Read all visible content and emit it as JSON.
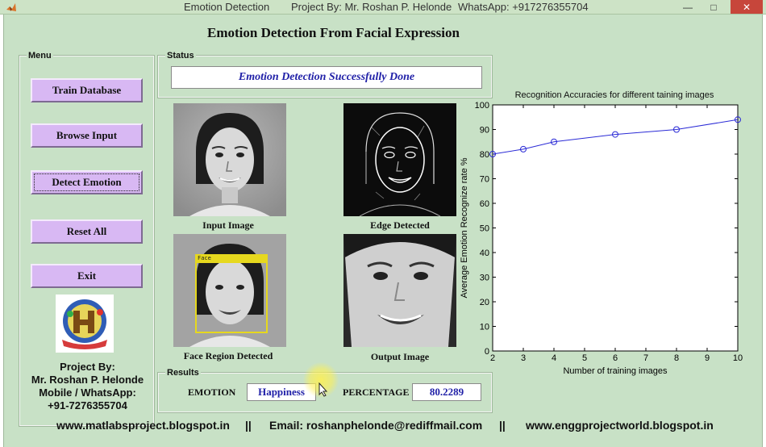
{
  "titlebar": {
    "app_name": "Emotion Detection",
    "project_by": "Project By: Mr. Roshan P. Helonde",
    "whatsapp": "WhatsApp: +917276355704"
  },
  "main_title": "Emotion Detection From Facial Expression",
  "menu": {
    "title": "Menu",
    "buttons": [
      "Train Database",
      "Browse Input",
      "Detect Emotion",
      "Reset All",
      "Exit"
    ]
  },
  "credits": {
    "line1": "Project By:",
    "line2": "Mr. Roshan P. Helonde",
    "line3": "Mobile / WhatsApp:",
    "line4": "+91-7276355704"
  },
  "status": {
    "title": "Status",
    "message": "Emotion Detection Successfully Done"
  },
  "images": {
    "input_caption": "Input Image",
    "edge_caption": "Edge Detected",
    "face_caption": "Face Region Detected",
    "output_caption": "Output Image",
    "face_box_label": "Face"
  },
  "results": {
    "title": "Results",
    "emotion_label": "EMOTION",
    "emotion_value": "Happiness",
    "percentage_label": "PERCENTAGE",
    "percentage_value": "80.2289"
  },
  "chart_data": {
    "type": "line",
    "title": "Recognition Accuracies for different taining images",
    "xlabel": "Number of training images",
    "ylabel": "Average Emotion Recognize rate %",
    "xlim": [
      2,
      10
    ],
    "ylim": [
      0,
      100
    ],
    "xticks": [
      2,
      3,
      4,
      5,
      6,
      7,
      8,
      9,
      10
    ],
    "yticks": [
      0,
      10,
      20,
      30,
      40,
      50,
      60,
      70,
      80,
      90,
      100
    ],
    "x": [
      2,
      3,
      4,
      6,
      8,
      10
    ],
    "y": [
      80,
      82,
      85,
      88,
      90,
      94
    ],
    "line_color": "#2b2bd6",
    "marker": "circle"
  },
  "footer": {
    "website1": "www.matlabsproject.blogspot.in",
    "sep": "||",
    "email": "Email: roshanphelonde@rediffmail.com",
    "website2": "www.enggprojectworld.blogspot.in"
  },
  "colors": {
    "window_bg": "#c8e1c6",
    "button_bg": "#d8b8f3",
    "status_text": "#2121a8",
    "close_button": "#c7463b"
  }
}
